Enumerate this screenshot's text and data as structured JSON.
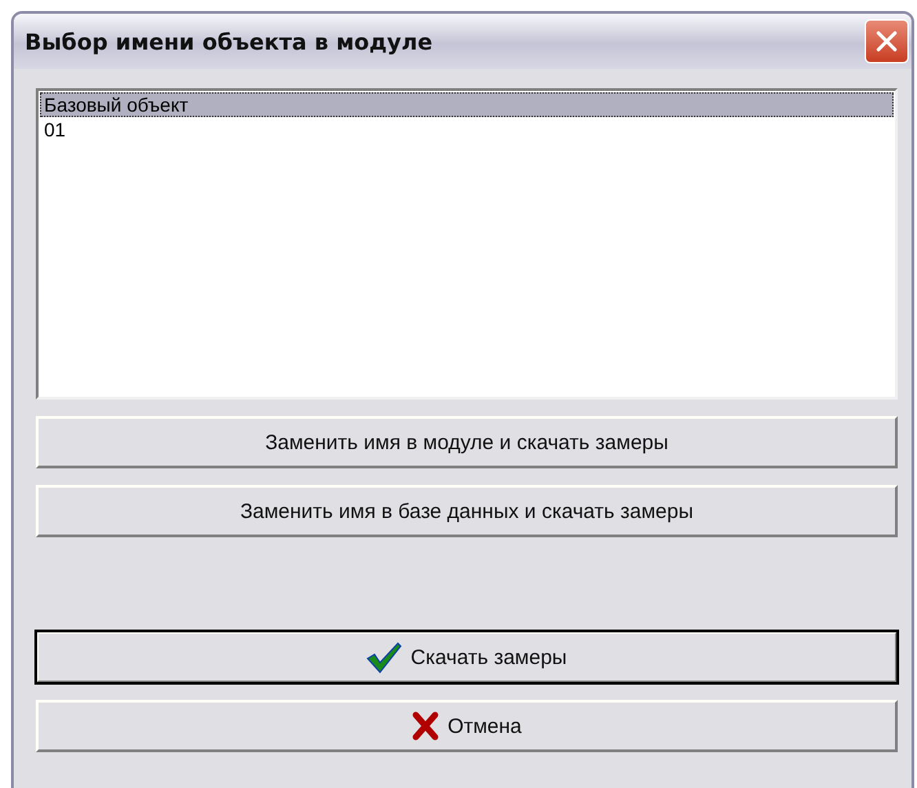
{
  "window": {
    "title": "Выбор имени объекта в модуле"
  },
  "list": {
    "items": [
      {
        "label": "Базовый объект",
        "selected": true
      },
      {
        "label": "01",
        "selected": false
      }
    ]
  },
  "buttons": [
    {
      "label": "Заменить имя в модуле и скачать замеры",
      "default": false
    },
    {
      "label": "Заменить имя в базе данных и скачать замеры",
      "default": false
    }
  ],
  "action_buttons": [
    {
      "label": "Скачать замеры",
      "kind": "check",
      "default": true
    },
    {
      "label": "Отмена",
      "kind": "cross",
      "default": false
    }
  ]
}
